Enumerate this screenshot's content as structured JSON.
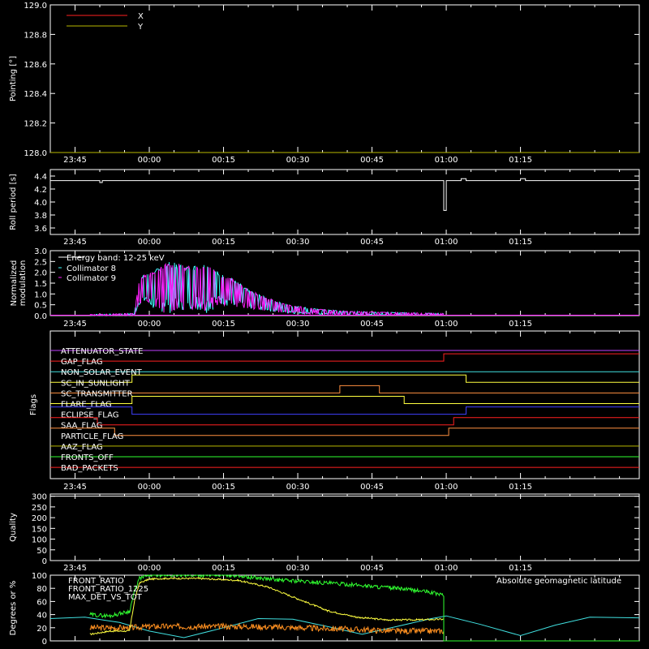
{
  "colors": {
    "background": "#000000",
    "axis": "#ffffff",
    "pointing_x": "#ff2020",
    "pointing_y": "#b8b800",
    "collimator_8": "#40ffff",
    "collimator_9": "#ff20ff",
    "front_ratio": "#ffff40",
    "front_ratio_1225": "#30ff30",
    "max_det_vs_tot": "#ff9020",
    "geomag": "#40e0e0",
    "quality": "#ffffff"
  },
  "time_ticks": [
    "23:45",
    "00:00",
    "00:15",
    "00:30",
    "00:45",
    "01:00",
    "01:15"
  ],
  "chart_data": [
    {
      "id": "pointing",
      "type": "line",
      "ylabel": "Pointing [°]",
      "ylim": [
        128.0,
        129.0
      ],
      "yticks": [
        "128.0",
        "128.2",
        "128.4",
        "128.6",
        "128.8",
        "129.0"
      ],
      "legend": [
        {
          "name": "X",
          "color": "#ff2020"
        },
        {
          "name": "Y",
          "color": "#b8b800"
        }
      ],
      "series": [
        {
          "name": "X",
          "color": "#ff2020",
          "x": [
            -20,
            99
          ],
          "y": [
            128.0,
            128.0
          ]
        },
        {
          "name": "Y",
          "color": "#b8b800",
          "x": [
            -20,
            99
          ],
          "y": [
            128.0,
            128.0
          ]
        }
      ]
    },
    {
      "id": "roll",
      "type": "line",
      "ylabel": "Roll period [s]",
      "ylim": [
        3.5,
        4.5
      ],
      "yticks": [
        "3.6",
        "3.8",
        "4.0",
        "4.2",
        "4.4"
      ],
      "series": [
        {
          "name": "roll",
          "color": "#ffffff",
          "x": [
            -20,
            -10,
            -10,
            -9.5,
            -9.5,
            30,
            59.5,
            59.5,
            60,
            60,
            60.5,
            60.5,
            63,
            63,
            64,
            64,
            75,
            75,
            76,
            76,
            99
          ],
          "y": [
            4.33,
            4.33,
            4.3,
            4.3,
            4.33,
            4.33,
            4.33,
            3.87,
            3.87,
            4.33,
            4.33,
            4.33,
            4.33,
            4.36,
            4.36,
            4.33,
            4.33,
            4.36,
            4.36,
            4.33,
            4.33
          ]
        }
      ]
    },
    {
      "id": "modulation",
      "type": "line",
      "ylabel": "Normalized modulation",
      "ylim": [
        0.0,
        3.0
      ],
      "yticks": [
        "0.0",
        "0.5",
        "1.0",
        "1.5",
        "2.0",
        "2.5",
        "3.0"
      ],
      "legend_title": "Energy band: 12-25 keV",
      "legend": [
        {
          "name": "Collimator 8",
          "color": "#40ffff"
        },
        {
          "name": "Collimator 9",
          "color": "#ff20ff"
        }
      ],
      "envelope": {
        "x": [
          -12,
          -3,
          -2,
          1,
          4,
          8,
          12,
          14,
          17,
          20,
          24,
          28,
          34,
          40,
          48,
          55,
          59.5
        ],
        "upper": [
          0.05,
          0.1,
          1.8,
          2.1,
          2.5,
          2.3,
          2.5,
          2.0,
          1.7,
          1.2,
          0.8,
          0.5,
          0.3,
          0.2,
          0.15,
          0.12,
          0.1
        ],
        "lower": [
          0.0,
          0.0,
          0.5,
          0.2,
          0.1,
          0.3,
          0.1,
          0.5,
          0.4,
          0.3,
          0.2,
          0.1,
          0.05,
          0.03,
          0.02,
          0.02,
          0.02
        ]
      }
    },
    {
      "id": "flags",
      "type": "step",
      "ylabel": "Flags",
      "flags": [
        {
          "label": "ATTENUATOR_STATE",
          "color": "#c040ff",
          "steps": [
            [
              -20,
              0
            ],
            [
              99,
              0
            ]
          ]
        },
        {
          "label": "GAP_FLAG",
          "color": "#ff2020",
          "steps": [
            [
              -20,
              0
            ],
            [
              59.5,
              0
            ],
            [
              59.5,
              1
            ],
            [
              99,
              1
            ]
          ]
        },
        {
          "label": "NON_SOLAR_EVENT",
          "color": "#40e0e0",
          "steps": [
            [
              -20,
              0
            ],
            [
              99,
              0
            ]
          ]
        },
        {
          "label": "SC_IN_SUNLIGHT",
          "color": "#ffff40",
          "steps": [
            [
              -20,
              0
            ],
            [
              -3.5,
              0
            ],
            [
              -3.5,
              1
            ],
            [
              64,
              1
            ],
            [
              64,
              0
            ],
            [
              99,
              0
            ]
          ]
        },
        {
          "label": "SC_TRANSMITTER",
          "color": "#ff9040",
          "steps": [
            [
              -20,
              0
            ],
            [
              38.5,
              0
            ],
            [
              38.5,
              1
            ],
            [
              46.5,
              1
            ],
            [
              46.5,
              0
            ],
            [
              99,
              0
            ]
          ]
        },
        {
          "label": "FLARE_FLAG",
          "color": "#ffff40",
          "steps": [
            [
              -20,
              0
            ],
            [
              -3.5,
              0
            ],
            [
              -3.5,
              1
            ],
            [
              51.5,
              1
            ],
            [
              51.5,
              0
            ],
            [
              99,
              0
            ]
          ]
        },
        {
          "label": "ECLIPSE_FLAG",
          "color": "#4040ff",
          "steps": [
            [
              -20,
              1
            ],
            [
              -3.5,
              1
            ],
            [
              -3.5,
              0
            ],
            [
              64,
              0
            ],
            [
              64,
              1
            ],
            [
              99,
              1
            ]
          ]
        },
        {
          "label": "SAA_FLAG",
          "color": "#ff2020",
          "steps": [
            [
              -20,
              1
            ],
            [
              -10.5,
              1
            ],
            [
              -10.5,
              0
            ],
            [
              61.5,
              0
            ],
            [
              61.5,
              1
            ],
            [
              99,
              1
            ]
          ]
        },
        {
          "label": "PARTICLE_FLAG",
          "color": "#ff9040",
          "steps": [
            [
              -20,
              1
            ],
            [
              -7,
              1
            ],
            [
              -7,
              0
            ],
            [
              60.5,
              0
            ],
            [
              60.5,
              1
            ],
            [
              99,
              1
            ]
          ]
        },
        {
          "label": "AAZ_FLAG",
          "color": "#b8b800",
          "steps": [
            [
              -20,
              0
            ],
            [
              99,
              0
            ]
          ]
        },
        {
          "label": "FRONTS_OFF",
          "color": "#30ff30",
          "steps": [
            [
              -20,
              0
            ],
            [
              99,
              0
            ]
          ]
        },
        {
          "label": "BAD_PACKETS",
          "color": "#ff2020",
          "steps": [
            [
              -20,
              0
            ],
            [
              99,
              0
            ]
          ]
        }
      ]
    },
    {
      "id": "quality",
      "type": "line",
      "ylabel": "Quality",
      "ylim": [
        0,
        310
      ],
      "yticks": [
        "0",
        "50",
        "100",
        "150",
        "200",
        "250",
        "300"
      ],
      "series": [
        {
          "name": "quality",
          "color": "#ffffff",
          "x": [
            -20,
            99
          ],
          "y": [
            300,
            300
          ]
        }
      ]
    },
    {
      "id": "ratios",
      "type": "line",
      "ylabel": "Degrees or %",
      "ylim": [
        0,
        100
      ],
      "yticks": [
        "0",
        "20",
        "40",
        "60",
        "80",
        "100"
      ],
      "legend": [
        {
          "name": "FRONT_RATIO",
          "color": "#ffff40"
        },
        {
          "name": "FRONT_RATIO_1225",
          "color": "#30ff30"
        },
        {
          "name": "MAX_DET_VS_TOT",
          "color": "#ff9020"
        }
      ],
      "annotation": {
        "text": "Absolute geomagnetic latitude",
        "color": "#40e0e0"
      },
      "series": [
        {
          "name": "FRONT_RATIO",
          "color": "#ffff40",
          "x": [
            -12,
            -8,
            -4,
            -3,
            -2,
            0,
            3,
            10,
            18,
            24,
            30,
            36,
            42,
            48,
            54,
            59.5,
            59.5,
            99
          ],
          "y": [
            10,
            15,
            15,
            60,
            88,
            94,
            95,
            95,
            92,
            82,
            64,
            46,
            36,
            32,
            32,
            33,
            0,
            0
          ]
        },
        {
          "name": "FRONT_RATIO_1225",
          "color": "#30ff30",
          "x": [
            -12,
            -8,
            -4,
            -3,
            -2,
            0,
            3,
            10,
            18,
            20,
            26,
            34,
            42,
            50,
            56,
            59.5,
            59.5,
            99
          ],
          "y": [
            40,
            38,
            45,
            75,
            95,
            100,
            100,
            100,
            100,
            97,
            93,
            89,
            85,
            80,
            75,
            70,
            0,
            0
          ]
        },
        {
          "name": "MAX_DET_VS_TOT",
          "color": "#ff9020",
          "x": [
            -12,
            -4,
            0,
            10,
            20,
            30,
            40,
            50,
            59.5,
            59.5,
            99
          ],
          "y": [
            20,
            20,
            22,
            22,
            22,
            20,
            18,
            15,
            15,
            0,
            0
          ]
        },
        {
          "name": "geomag",
          "color": "#40e0e0",
          "x": [
            -20,
            -13,
            -6,
            0,
            7,
            15,
            22,
            29,
            36,
            43,
            50,
            57,
            60,
            67,
            75,
            82,
            89,
            99
          ],
          "y": [
            34,
            36,
            28,
            15,
            5,
            20,
            34,
            33,
            22,
            10,
            22,
            34,
            38,
            25,
            8,
            24,
            36,
            35
          ]
        }
      ]
    }
  ]
}
